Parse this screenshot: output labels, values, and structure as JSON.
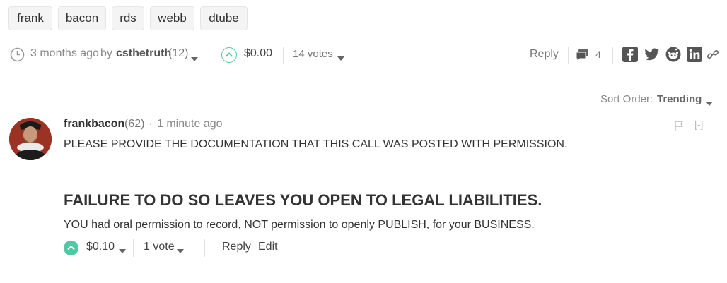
{
  "tags": [
    "frank",
    "bacon",
    "rds",
    "webb",
    "dtube"
  ],
  "post_meta": {
    "time": "3 months ago",
    "by": "by",
    "author": "csthetruth",
    "reputation": "(12)",
    "payout": "$0.00",
    "votes": "14 votes",
    "reply": "Reply",
    "comment_count": "4"
  },
  "sort": {
    "label": "Sort Order:",
    "value": "Trending"
  },
  "comment": {
    "author": "frankbacon",
    "reputation": "(62)",
    "dot": "·",
    "time": "1 minute ago",
    "collapse": "[-]",
    "line1": "PLEASE PROVIDE THE DOCUMENTATION THAT THIS CALL WAS POSTED WITH PERMISSION.",
    "heading": "FAILURE TO DO SO LEAVES YOU OPEN TO LEGAL LIABILITIES.",
    "line2": "YOU had oral permission to record, NOT permission to openly PUBLISH, for your BUSINESS.",
    "payout": "$0.10",
    "votes": "1 vote",
    "reply": "Reply",
    "edit": "Edit"
  },
  "icons": {
    "clock": "clock-icon",
    "upvote": "upvote-icon",
    "comments": "comments-icon",
    "facebook": "facebook-icon",
    "twitter": "twitter-icon",
    "reddit": "reddit-icon",
    "linkedin": "linkedin-icon",
    "link": "link-icon",
    "flag": "flag-icon"
  },
  "colors": {
    "upvote_accent": "#4fc99f",
    "text": "#333333",
    "muted": "#888888"
  }
}
